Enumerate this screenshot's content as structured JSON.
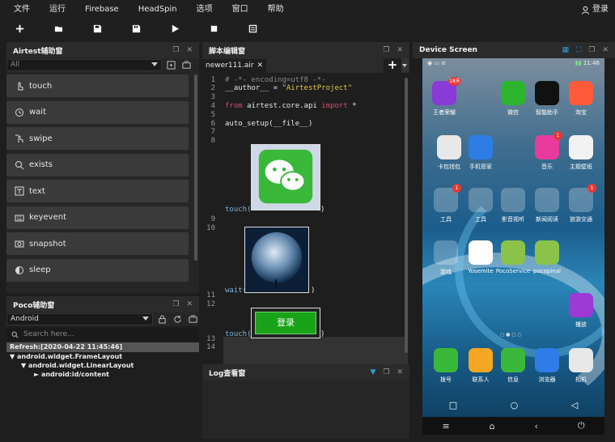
{
  "menu": [
    "文件",
    "运行",
    "Firebase",
    "HeadSpin",
    "选项",
    "窗口",
    "帮助"
  ],
  "login_label": "登录",
  "airtest_panel": {
    "title": "Airtest辅助窗",
    "filter_value": "All",
    "apis": [
      "touch",
      "wait",
      "swipe",
      "exists",
      "text",
      "keyevent",
      "snapshot",
      "sleep"
    ]
  },
  "poco_panel": {
    "title": "Poco辅助窗",
    "platform": "Android",
    "search_placeholder": "Search here...",
    "refresh": "Refresh:[2020-04-22 11:45:46]",
    "tree": [
      "android.widget.FrameLayout",
      "android.widget.LinearLayout",
      "android:id/content"
    ]
  },
  "editor": {
    "title": "脚本编辑窗",
    "tab": "newer111.air",
    "line_numbers": [
      "1",
      "2",
      "3",
      "4",
      "5",
      "6",
      "7",
      "8",
      "9",
      "10",
      "11",
      "12",
      "13",
      "14"
    ],
    "code": {
      "l1": "# -*- encoding=utf8 -*-",
      "l2_a": "__author__ = ",
      "l2_b": "\"AirtestProject\"",
      "l4_a": "from",
      "l4_b": " airtest.core.api ",
      "l4_c": "import",
      "l4_d": " *",
      "l6": "auto_setup(__file__)",
      "touch1": "touch(",
      "wait": "wait(",
      "touch2": "touch(",
      "close_paren": ")"
    },
    "login_image_text": "登录"
  },
  "log_panel": {
    "title": "Log查看窗"
  },
  "device_panel": {
    "title": "Device Screen",
    "status_time": "11:46",
    "apps": [
      {
        "label": "王者荣耀",
        "badge": "18天"
      },
      {
        "label": "微信",
        "badge": ""
      },
      {
        "label": "智能助手",
        "badge": ""
      },
      {
        "label": "淘宝",
        "badge": ""
      },
      {
        "label": "卡包钱包",
        "badge": ""
      },
      {
        "label": "手机管家",
        "badge": ""
      },
      {
        "label": "音乐",
        "badge": "1"
      },
      {
        "label": "主题壁纸",
        "badge": ""
      },
      {
        "label": "工具",
        "badge": "1"
      },
      {
        "label": "工具",
        "badge": ""
      },
      {
        "label": "影音视听",
        "badge": ""
      },
      {
        "label": "新闻阅读",
        "badge": ""
      },
      {
        "label": "旅游交通",
        "badge": "1"
      },
      {
        "label": "游戏",
        "badge": ""
      },
      {
        "label": "Yosemite",
        "badge": ""
      },
      {
        "label": "PocoService",
        "badge": ""
      },
      {
        "label": "pocopinal",
        "badge": ""
      },
      {
        "label": "播放",
        "badge": ""
      }
    ],
    "dock": [
      "拨号",
      "联系人",
      "信息",
      "浏览器",
      "相机"
    ]
  }
}
